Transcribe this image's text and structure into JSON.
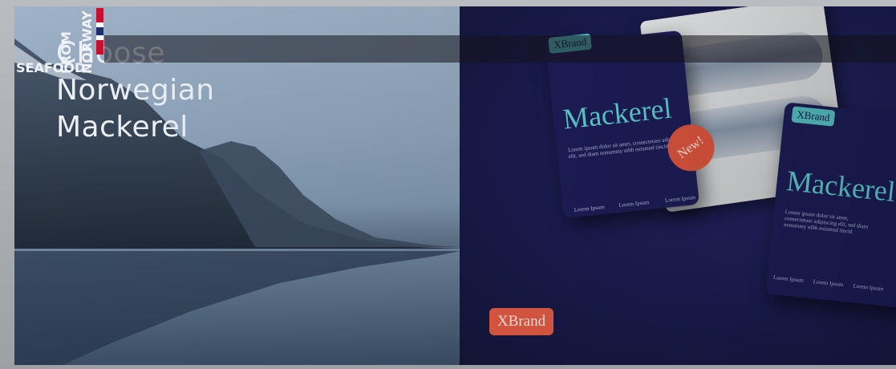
{
  "headline": {
    "lines": [
      "Choose",
      "Norwegian",
      "Mackerel"
    ]
  },
  "logo": {
    "line1": "SEAFOOD",
    "line2": "FROM",
    "line3": "NORWAY",
    "flag_colors": [
      "#c8102e",
      "#ffffff",
      "#1d2f6f"
    ]
  },
  "product": {
    "brand": "XBrand",
    "title": "Mackerel",
    "body": "Lorem ipsum dolor sit amet, consectetuer adipiscing elit, sed diam nonummy nibh euismod tincid",
    "footer_item": "Lorem Ipsum",
    "badge": "New!"
  },
  "brand_tag": "XBrand",
  "colors": {
    "navy": "#1c1d4a",
    "teal": "#5fd0d2",
    "coral": "#e35b43",
    "sky": "#9fb2c6"
  }
}
